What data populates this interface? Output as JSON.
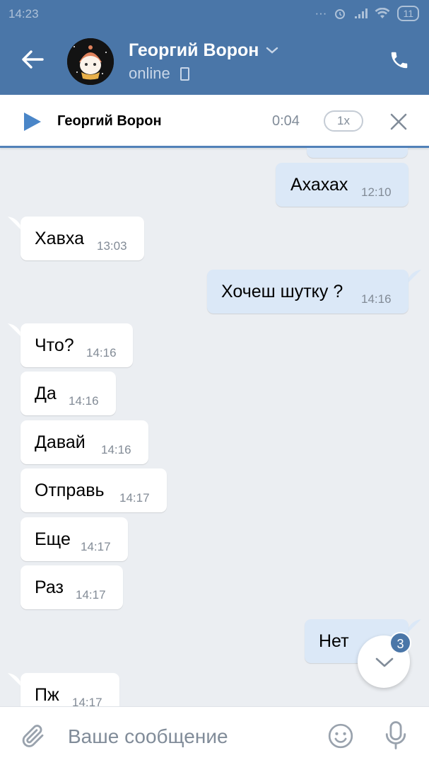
{
  "statusbar": {
    "time": "14:23",
    "battery": "11"
  },
  "header": {
    "contact_name": "Георгий Ворон",
    "status": "online"
  },
  "player": {
    "title": "Георгий Ворон",
    "duration": "0:04",
    "speed": "1x"
  },
  "messages": [
    {
      "dir": "out",
      "text": "Ахахах",
      "time": "12:10"
    },
    {
      "dir": "in",
      "text": "Хавха",
      "time": "13:03"
    },
    {
      "dir": "out",
      "text": "Хочеш шутку ?",
      "time": "14:16"
    },
    {
      "dir": "in",
      "text": "Что?",
      "time": "14:16"
    },
    {
      "dir": "in",
      "text": "Да",
      "time": "14:16"
    },
    {
      "dir": "in",
      "text": "Давай",
      "time": "14:16"
    },
    {
      "dir": "in",
      "text": "Отправь",
      "time": "14:17"
    },
    {
      "dir": "in",
      "text": "Еще",
      "time": "14:17"
    },
    {
      "dir": "in",
      "text": "Раз",
      "time": "14:17"
    },
    {
      "dir": "out",
      "text": "Нет",
      "time": ""
    },
    {
      "dir": "in",
      "text": "Пж",
      "time": "14:17"
    }
  ],
  "scroll_badge": "3",
  "composer": {
    "placeholder": "Ваше сообщение"
  },
  "colors": {
    "brand": "#4a76a8",
    "outgoing_bubble": "#dbe8f7",
    "incoming_bubble": "#ffffff",
    "chat_bg": "#ebeef2"
  }
}
